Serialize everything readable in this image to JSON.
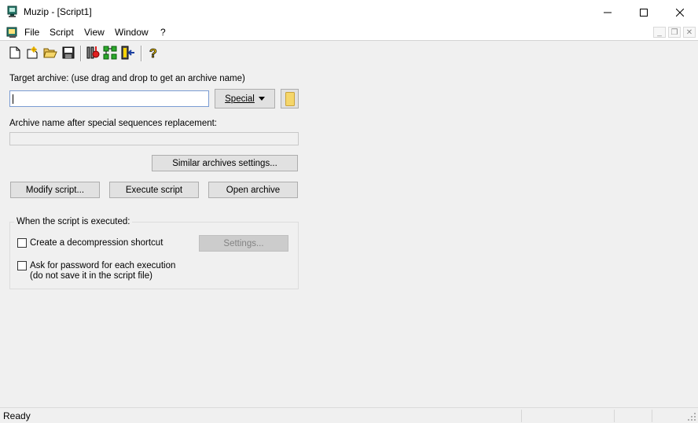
{
  "window": {
    "title": "Muzip - [Script1]",
    "controls": {
      "minimize": "—",
      "maximize": "□",
      "close": "✕"
    }
  },
  "menu": {
    "items": [
      "File",
      "Script",
      "View",
      "Window",
      "?"
    ],
    "mdi_controls": {
      "minimize": "_",
      "restore": "❐",
      "close": "✕"
    }
  },
  "toolbar": {
    "icons": [
      "new-icon",
      "wizard-icon",
      "open-folder-icon",
      "save-icon",
      "modify-script-icon",
      "execute-script-icon",
      "open-archive-icon",
      "help-icon"
    ]
  },
  "form": {
    "target_label": "Target archive: (use drag and drop to get an archive name)",
    "target_value": "",
    "special_label": "Special",
    "archive_name_label": "Archive name after special sequences replacement:",
    "archive_name_value": "",
    "similar_button": "Similar archives settings...",
    "modify_button": "Modify script...",
    "execute_button": "Execute script",
    "open_button": "Open archive"
  },
  "group": {
    "title": "When the script is executed:",
    "create_shortcut_label": "Create a decompression shortcut",
    "create_shortcut_checked": false,
    "settings_button": "Settings...",
    "ask_password_label": "Ask for password for each execution",
    "ask_password_sub": "(do not save it in the script file)",
    "ask_password_checked": false
  },
  "status": {
    "text": "Ready"
  },
  "colors": {
    "folder": "#f5d66a",
    "input_border": "#7a9cd3",
    "disabled_btn": "#cccccc"
  }
}
